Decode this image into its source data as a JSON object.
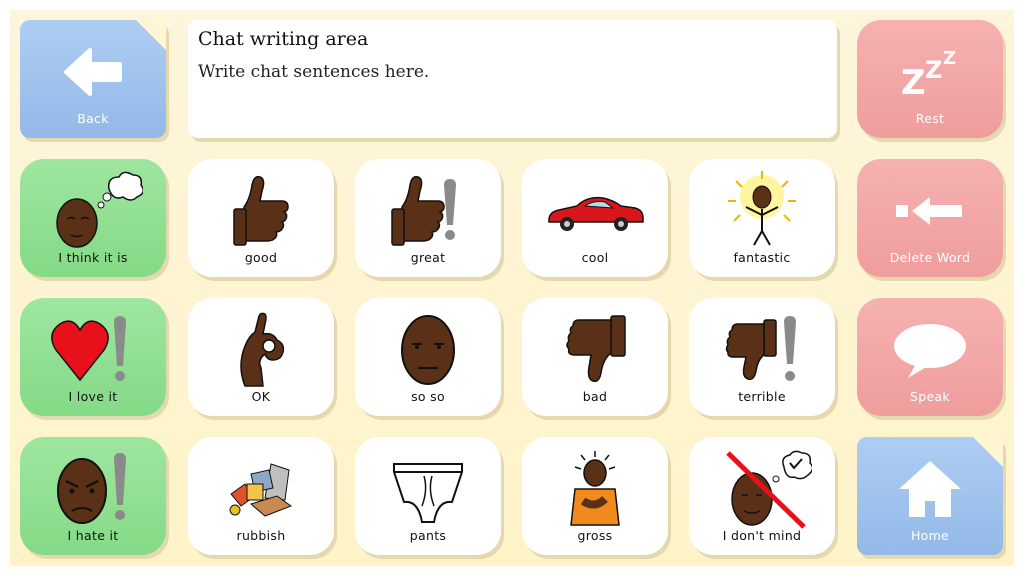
{
  "nav": {
    "back_label": "Back",
    "rest_label": "Rest",
    "delete_label": "Delete Word",
    "speak_label": "Speak",
    "home_label": "Home"
  },
  "chat": {
    "title": "Chat writing area",
    "hint": "Write chat sentences here."
  },
  "left": {
    "think": "I think it is",
    "love": "I love it",
    "hate": "I hate it"
  },
  "words": {
    "good": "good",
    "great": "great",
    "cool": "cool",
    "fantastic": "fantastic",
    "ok": "OK",
    "soso": "so so",
    "bad": "bad",
    "terrible": "terrible",
    "rubbish": "rubbish",
    "pants": "pants",
    "gross": "gross",
    "dontmind": "I don't mind"
  },
  "colors": {
    "green": "#8cdc8d",
    "pink": "#f2a5a5",
    "blue": "#9ec2ec",
    "skin": "#5a3116",
    "background": "#fdf3d0"
  }
}
